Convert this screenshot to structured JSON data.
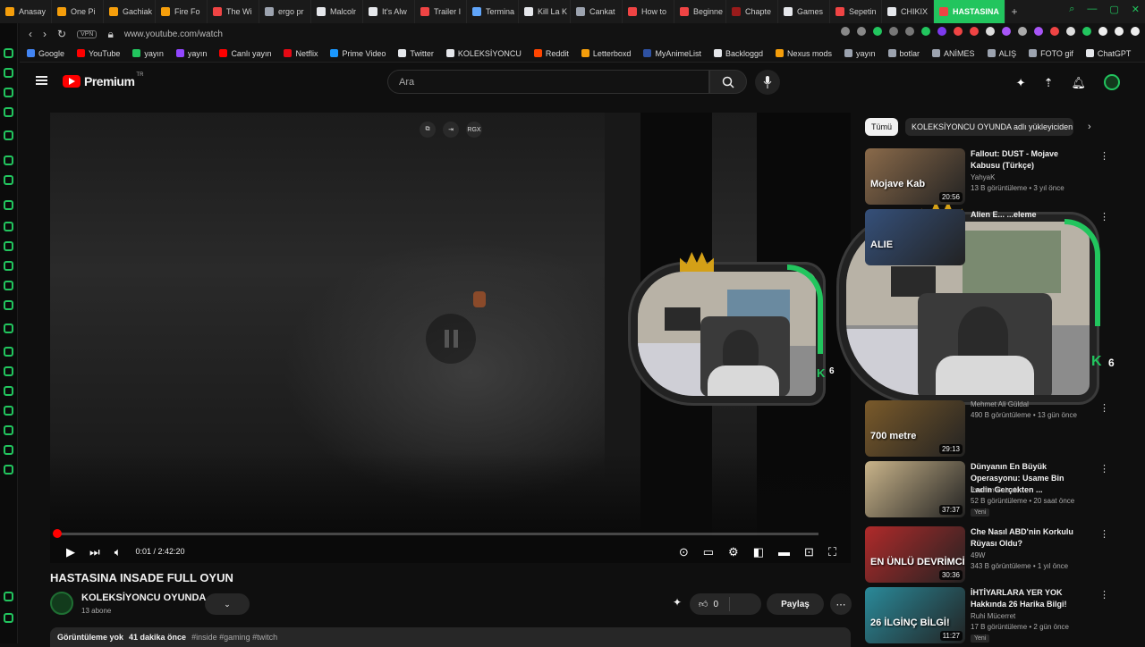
{
  "tabs": [
    {
      "label": "Anasay",
      "color": "#f59e0b"
    },
    {
      "label": "One Pi",
      "color": "#f59e0b"
    },
    {
      "label": "Gachiak",
      "color": "#f59e0b"
    },
    {
      "label": "Fire Fo",
      "color": "#f59e0b"
    },
    {
      "label": "The Wi",
      "color": "#ef4444"
    },
    {
      "label": "ergo pr",
      "color": "#9ca3af"
    },
    {
      "label": "Malcolr",
      "color": "#e5e7eb"
    },
    {
      "label": "It's Alw",
      "color": "#e5e7eb"
    },
    {
      "label": "Trailer I",
      "color": "#ef4444"
    },
    {
      "label": "Termina",
      "color": "#60a5fa"
    },
    {
      "label": "Kill La K",
      "color": "#e5e7eb"
    },
    {
      "label": "Cankat",
      "color": "#9ca3af"
    },
    {
      "label": "How to",
      "color": "#ef4444"
    },
    {
      "label": "Beginne",
      "color": "#ef4444"
    },
    {
      "label": "Chapte",
      "color": "#991b1b"
    },
    {
      "label": "Games",
      "color": "#e5e7eb"
    },
    {
      "label": "Sepetin",
      "color": "#ef4444"
    },
    {
      "label": "CHIKIX",
      "color": "#e5e7eb"
    }
  ],
  "active_tab": {
    "label": "HASTASINA",
    "color": "#ef4444"
  },
  "address": {
    "url": "www.youtube.com/watch",
    "vpn": "VPN"
  },
  "bookmarks": [
    {
      "label": "Google",
      "color": "#4285f4"
    },
    {
      "label": "YouTube",
      "color": "#ff0000"
    },
    {
      "label": "yayın",
      "color": "#22c55e"
    },
    {
      "label": "yayın",
      "color": "#9146ff"
    },
    {
      "label": "Canlı yayın",
      "color": "#ff0000"
    },
    {
      "label": "Netflix",
      "color": "#e50914"
    },
    {
      "label": "Prime Video",
      "color": "#1a98ff"
    },
    {
      "label": "Twitter",
      "color": "#e5e7eb"
    },
    {
      "label": "KOLEKSİYONCU",
      "color": "#e5e7eb"
    },
    {
      "label": "Reddit",
      "color": "#ff4500"
    },
    {
      "label": "Letterboxd",
      "color": "#f59e0b"
    },
    {
      "label": "MyAnimeList",
      "color": "#2e51a2"
    },
    {
      "label": "Backloggd",
      "color": "#e5e7eb"
    },
    {
      "label": "Nexus mods",
      "color": "#f59e0b"
    },
    {
      "label": "yayın",
      "color": "#9ca3af"
    },
    {
      "label": "botlar",
      "color": "#9ca3af"
    },
    {
      "label": "ANİMES",
      "color": "#9ca3af"
    },
    {
      "label": "ALIŞ",
      "color": "#9ca3af"
    },
    {
      "label": "FOTO gif",
      "color": "#9ca3af"
    },
    {
      "label": "ChatGPT",
      "color": "#e5e7eb"
    }
  ],
  "youtube": {
    "logo": "Premium",
    "logo_sup": "TR",
    "search_placeholder": "Ara"
  },
  "player": {
    "time": "0:01 / 2:42:20",
    "progress_fraction": 0.0001,
    "top_ctrl_label": "RGX"
  },
  "overlay": {
    "k_badge": "K",
    "k_count": "6"
  },
  "video": {
    "title": "HASTASINA INSADE FULL OYUN",
    "channel": "KOLEKSİYONCU OYUNDA",
    "subs": "13 abone",
    "likes": "0",
    "share": "Paylaş",
    "views": "Görüntüleme yok",
    "posted": "41 dakika önce",
    "tags": "#inside #gaming #twitch"
  },
  "chips": {
    "all": "Tümü",
    "channel": "KOLEKSİYONCU OYUNDA adlı yükleyiciden"
  },
  "recommendations": [
    {
      "title": "Fallout: DUST - Mojave Kabusu (Türkçe)",
      "channel": "YahyaK",
      "meta": "13 B görüntüleme • 3 yıl önce",
      "duration": "20:56",
      "thumb_text": "Mojave Kab",
      "thumb_color": "#8a6a4a",
      "new": ""
    },
    {
      "title": "Alien E... ...eleme",
      "channel": "",
      "meta": "",
      "duration": "",
      "thumb_text": "ALIE",
      "thumb_color": "#35507a",
      "new": ""
    },
    {
      "title": "",
      "channel": "Mehmet Ali Güldal",
      "meta": "490 B görüntüleme • 13 gün önce",
      "duration": "29:13",
      "thumb_text": "700 metre",
      "thumb_color": "#7a5a2a",
      "new": ""
    },
    {
      "title": "Dünyanın En Büyük Operasyonu: Usame Bin Ladin Gerçekten ...",
      "channel": "İbrahim Balsak",
      "meta": "52 B görüntüleme • 20 saat önce",
      "duration": "37:37",
      "thumb_text": "",
      "thumb_color": "#c9b48a",
      "new": "Yeni"
    },
    {
      "title": "Che Nasıl ABD'nin Korkulu Rüyası Oldu?",
      "channel": "49W",
      "meta": "343 B görüntüleme • 1 yıl önce",
      "duration": "30:36",
      "thumb_text": "EN ÜNLÜ DEVRİMCİ",
      "thumb_color": "#b02a2a",
      "new": ""
    },
    {
      "title": "İHTİYARLARA YER YOK Hakkında 26 Harika Bilgi!",
      "channel": "Ruhi Mücerret",
      "meta": "17 B görüntüleme • 2 gün önce",
      "duration": "11:27",
      "thumb_text": "26 İLGİNÇ BİLGİ!",
      "thumb_color": "#2a8a9a",
      "new": "Yeni"
    }
  ]
}
